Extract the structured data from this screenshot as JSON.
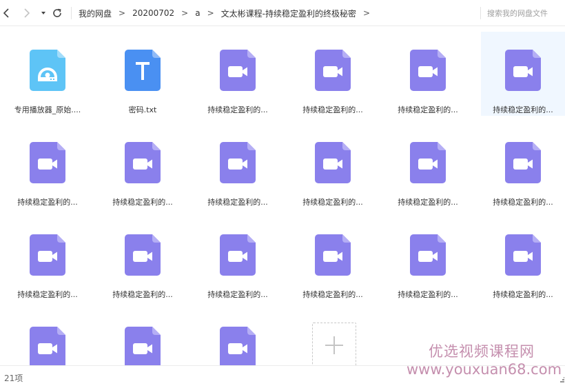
{
  "toolbar": {
    "breadcrumbs": [
      "我的网盘",
      "20200702",
      "a",
      "文太彬课程-持续稳定盈利的终极秘密"
    ],
    "separator": ">",
    "search_placeholder": "搜索我的网盘文件"
  },
  "files": [
    {
      "name": "专用播放器_原始....",
      "type": "player"
    },
    {
      "name": "密码.txt",
      "type": "text"
    },
    {
      "name": "持续稳定盈利的...",
      "type": "video"
    },
    {
      "name": "持续稳定盈利的...",
      "type": "video"
    },
    {
      "name": "持续稳定盈利的...",
      "type": "video"
    },
    {
      "name": "持续稳定盈利的...",
      "type": "video",
      "selected": true
    },
    {
      "name": "持续稳定盈利的...",
      "type": "video"
    },
    {
      "name": "持续稳定盈利的...",
      "type": "video"
    },
    {
      "name": "持续稳定盈利的...",
      "type": "video"
    },
    {
      "name": "持续稳定盈利的...",
      "type": "video"
    },
    {
      "name": "持续稳定盈利的...",
      "type": "video"
    },
    {
      "name": "持续稳定盈利的...",
      "type": "video"
    },
    {
      "name": "持续稳定盈利的...",
      "type": "video"
    },
    {
      "name": "持续稳定盈利的...",
      "type": "video"
    },
    {
      "name": "持续稳定盈利的...",
      "type": "video"
    },
    {
      "name": "持续稳定盈利的...",
      "type": "video"
    },
    {
      "name": "持续稳定盈利的...",
      "type": "video"
    },
    {
      "name": "持续稳定盈利的...",
      "type": "video"
    },
    {
      "name": "",
      "type": "video"
    },
    {
      "name": "",
      "type": "video"
    },
    {
      "name": "",
      "type": "video"
    }
  ],
  "icons": {
    "back": "chevron-left-icon",
    "forward": "chevron-right-icon",
    "dropdown": "caret-down-icon",
    "refresh": "refresh-icon",
    "new": "plus-icon"
  },
  "colors": {
    "video": "#8a80ec",
    "video_fold": "#b5aef5",
    "text": "#4a90f2",
    "text_fold": "#8fbaf7",
    "player": "#5ec4f6",
    "player_fold": "#a2dcfa",
    "selected_bg": "#f0f7ff"
  },
  "status": {
    "count": "21项"
  },
  "watermark": {
    "line1": "优选视频课程网",
    "line2": "www.youxuan68.com"
  }
}
